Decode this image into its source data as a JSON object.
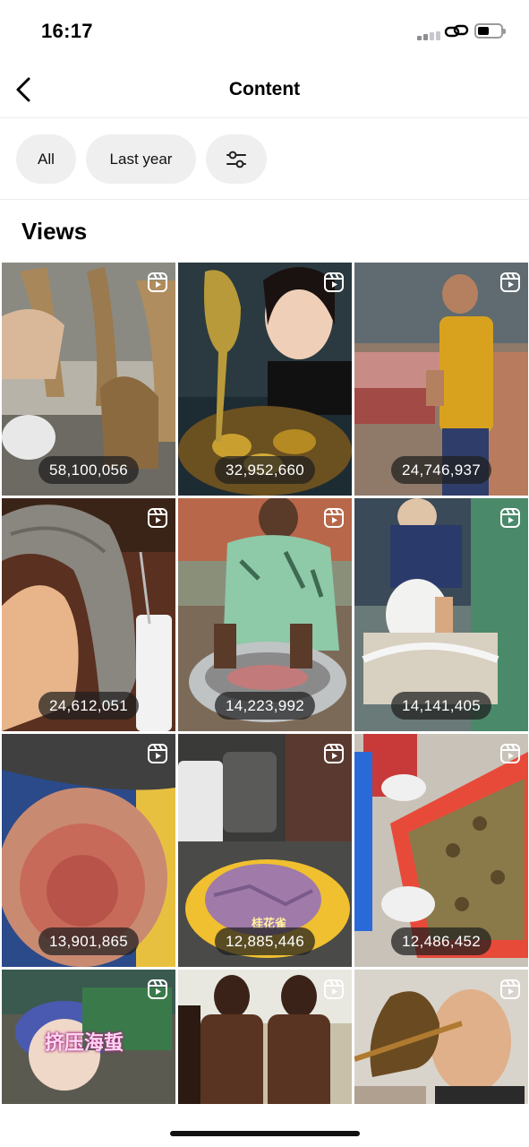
{
  "status_bar": {
    "time": "16:17"
  },
  "header": {
    "title": "Content",
    "back_icon": "chevron-left-icon"
  },
  "filters": [
    {
      "label": "All"
    },
    {
      "label": "Last year"
    },
    {
      "icon": "sliders-icon"
    }
  ],
  "section": {
    "title": "Views"
  },
  "grid": {
    "items": [
      {
        "views": "58,100,056"
      },
      {
        "views": "32,952,660"
      },
      {
        "views": "24,746,937"
      },
      {
        "views": "24,612,051"
      },
      {
        "views": "14,223,992"
      },
      {
        "views": "14,141,405"
      },
      {
        "views": "13,901,865"
      },
      {
        "views": "12,885,446",
        "caption": "桂花雀"
      },
      {
        "views": "12,486,452"
      },
      {
        "views": "",
        "caption": "挤压海蜇"
      },
      {
        "views": ""
      },
      {
        "views": ""
      }
    ]
  },
  "colors": {
    "chip_bg": "#efefef",
    "pill_bg": "#1e1e1e",
    "divider": "#ececec"
  }
}
